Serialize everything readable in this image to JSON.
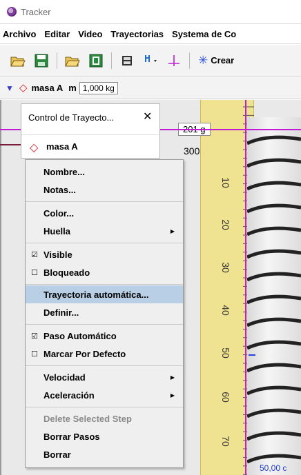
{
  "window": {
    "title": "Tracker"
  },
  "menubar": {
    "items": [
      "Archivo",
      "Editar",
      "Video",
      "Trayectorias",
      "Systema de Co"
    ]
  },
  "toolbar": {
    "create_label": "Crear"
  },
  "trackbar": {
    "track_name": "masa A",
    "mass_label": "m",
    "mass_value": "1,000 kg"
  },
  "video": {
    "image_label": "201 g",
    "partial_label": "300",
    "distance_label": "50,00 c",
    "ruler_numbers": [
      "10",
      "20",
      "30",
      "40",
      "50",
      "60",
      "70"
    ]
  },
  "control_panel": {
    "title": "Control de Trayecto...",
    "track_name": "masa A"
  },
  "context_menu": {
    "nombre": "Nombre...",
    "notas": "Notas...",
    "color": "Color...",
    "huella": "Huella",
    "visible": "Visible",
    "bloqueado": "Bloqueado",
    "trayectoria_auto": "Trayectoria automática...",
    "definir": "Definir...",
    "paso_auto": "Paso Automático",
    "marcar": "Marcar Por Defecto",
    "velocidad": "Velocidad",
    "aceleracion": "Aceleración",
    "delete_step": "Delete Selected Step",
    "borrar_pasos": "Borrar Pasos",
    "borrar": "Borrar"
  },
  "colors": {
    "accent_magenta": "#c21bd6",
    "track_red": "#e02020",
    "highlight": "#b8cfe5"
  }
}
